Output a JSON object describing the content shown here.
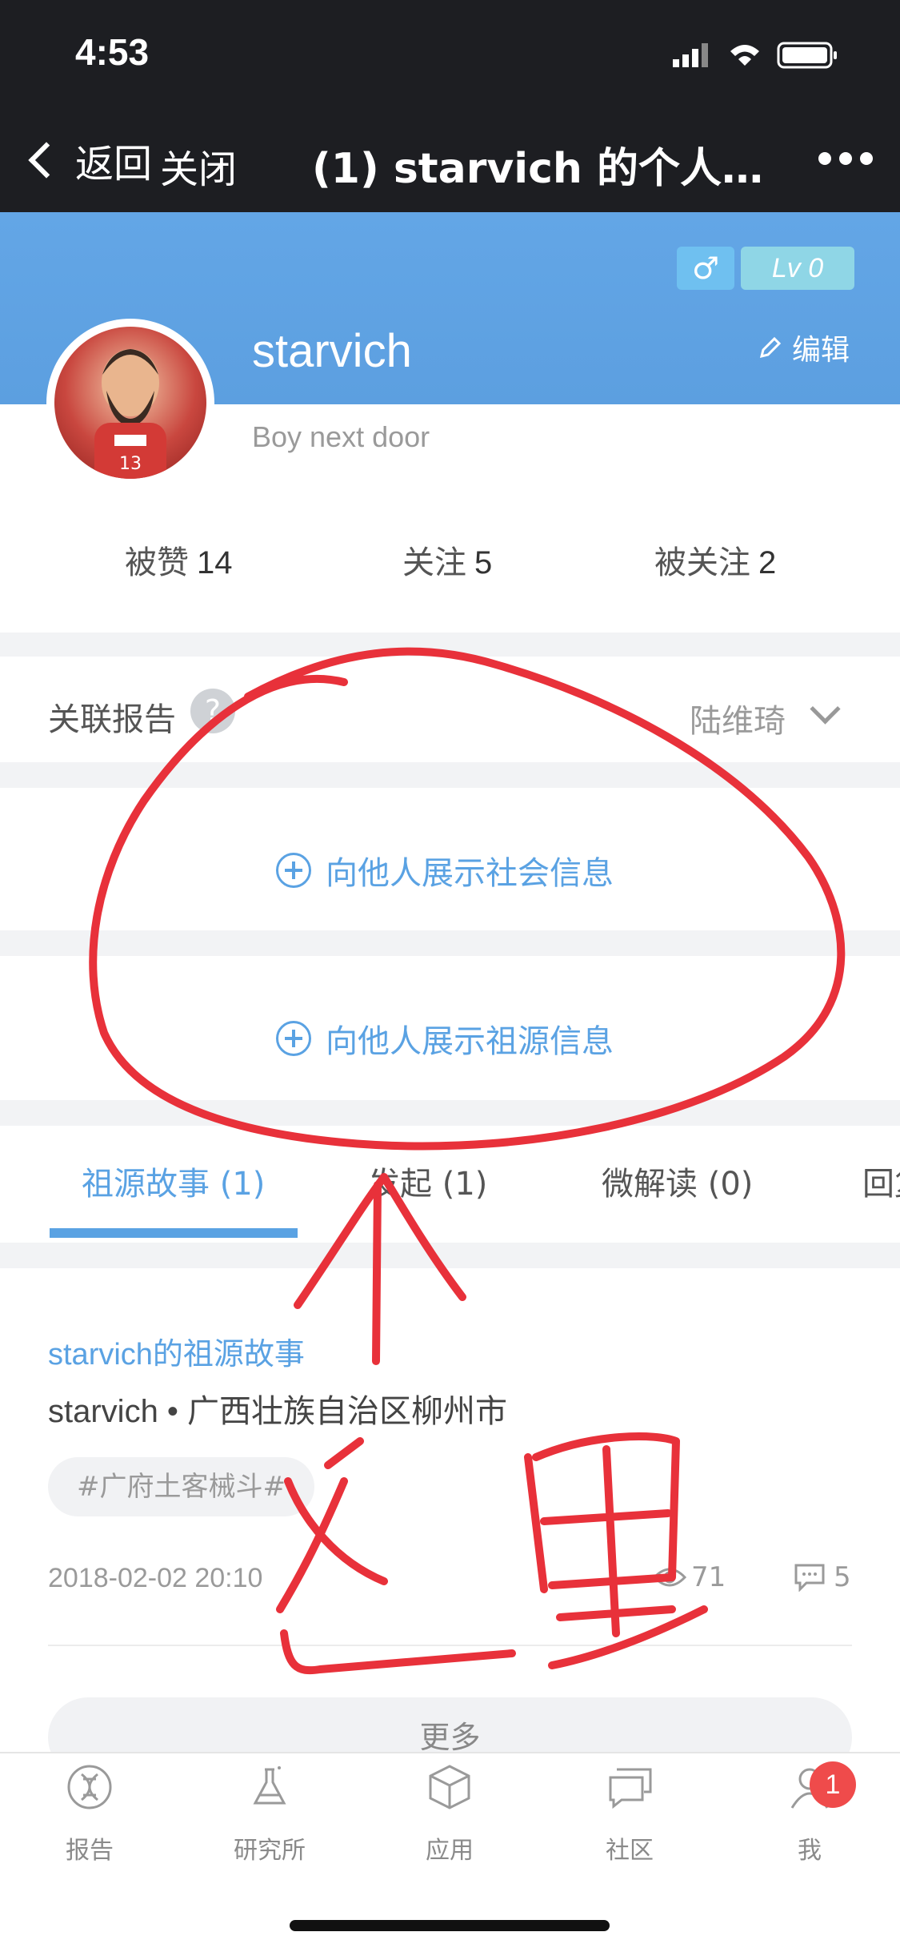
{
  "status_bar": {
    "time": "4:53"
  },
  "nav": {
    "back_label": "返回",
    "close_label": "关闭",
    "title": "(1) starvich 的个人…"
  },
  "profile": {
    "gender_symbol": "♂",
    "level": "Lv 0",
    "edit_label": "编辑",
    "username": "starvich",
    "bio": "Boy next door"
  },
  "stats": [
    {
      "label": "被赞",
      "value": "14"
    },
    {
      "label": "关注",
      "value": "5"
    },
    {
      "label": "被关注",
      "value": "2"
    }
  ],
  "related_report": {
    "label": "关联报告",
    "help": "?",
    "person": "陆维琦"
  },
  "actions": {
    "show_social": "向他人展示社会信息",
    "show_ancestry": "向他人展示祖源信息"
  },
  "tabs": [
    {
      "label": "祖源故事 (1)"
    },
    {
      "label": "发起 (1)"
    },
    {
      "label": "微解读 (0)"
    },
    {
      "label": "回复"
    }
  ],
  "story": {
    "title": "starvich的祖源故事",
    "meta": "starvich • 广西壮族自治区柳州市",
    "tag": "#广府土客械斗#",
    "date": "2018-02-02 20:10",
    "views": "71",
    "comments": "5"
  },
  "more_label": "更多",
  "tabbar": [
    {
      "label": "报告",
      "icon": "dna-icon"
    },
    {
      "label": "研究所",
      "icon": "flask-icon"
    },
    {
      "label": "应用",
      "icon": "cube-icon"
    },
    {
      "label": "社区",
      "icon": "chat-icon"
    },
    {
      "label": "我",
      "icon": "user-icon"
    }
  ],
  "tabbar_badge": "1",
  "annotation": {
    "text": "这里"
  },
  "colors": {
    "accent": "#5aa2e3",
    "annotation": "#e8313a",
    "badge": "#ef4b4b"
  }
}
